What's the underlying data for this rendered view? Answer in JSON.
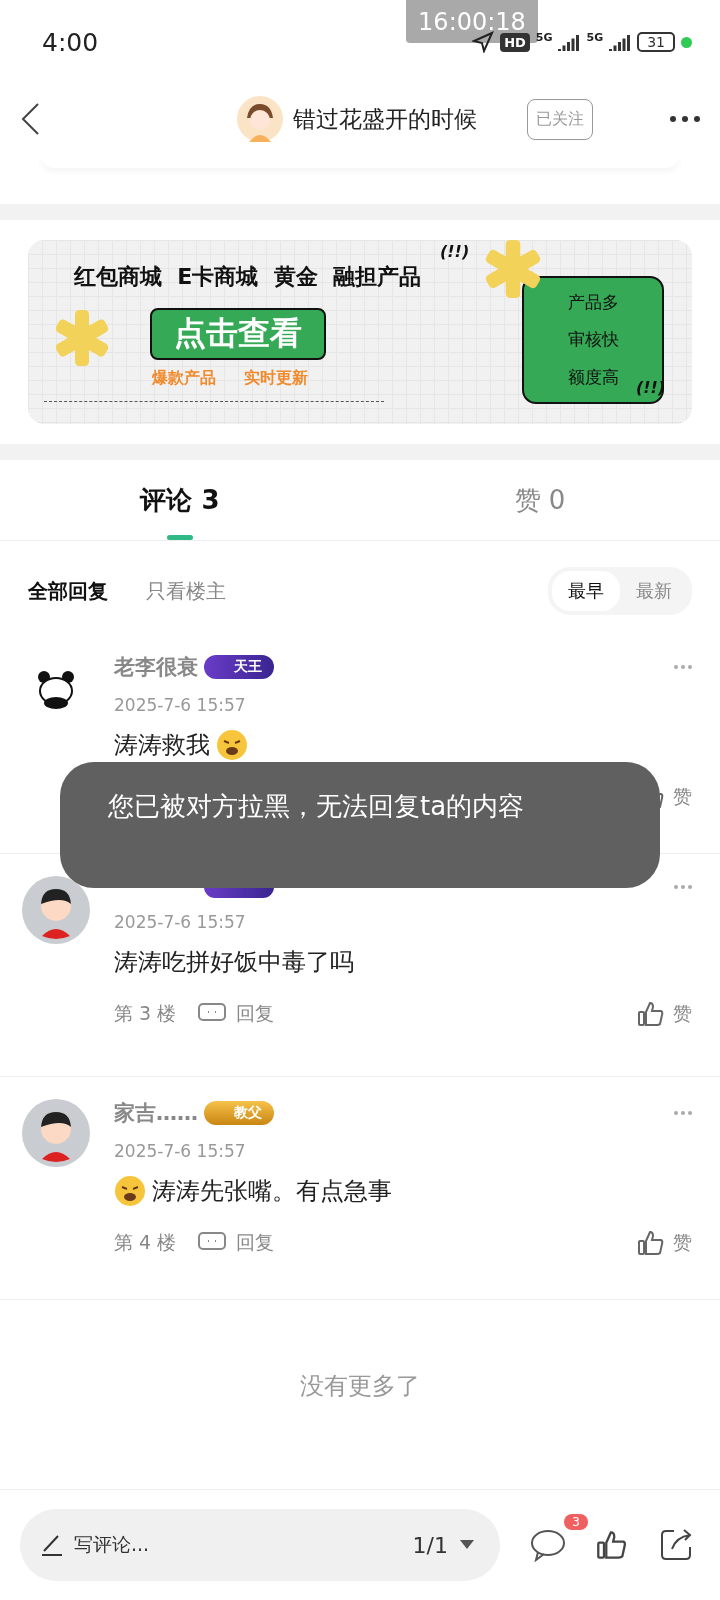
{
  "status_bar": {
    "time": "4:00",
    "recorder": "16:00:18",
    "hd": "HD",
    "networks": [
      "5G",
      "5G"
    ],
    "battery": "31"
  },
  "header": {
    "title": "错过花盛开的时候",
    "follow": "已关注"
  },
  "banner": {
    "headline": "红包商城  E卡商城  黄金  融担产品",
    "button": "点击查看",
    "tags": [
      "爆款产品",
      "实时更新"
    ],
    "features": [
      "产品多",
      "审核快",
      "额度高"
    ],
    "exclaims": [
      "(!!)",
      "(!!)"
    ]
  },
  "tabs": [
    {
      "label": "评论 3",
      "selected": true
    },
    {
      "label": "赞 0",
      "selected": false
    }
  ],
  "filters": [
    {
      "label": "全部回复",
      "selected": true
    },
    {
      "label": "只看楼主",
      "selected": false
    }
  ],
  "sort": [
    {
      "label": "最早",
      "selected": true
    },
    {
      "label": "最新",
      "selected": false
    }
  ],
  "comments": [
    {
      "name": "老李很衰",
      "avatar": {
        "kind": "panda"
      },
      "badge": {
        "kind": "tianwang",
        "text": "天王"
      },
      "time": "2025-7-6 15:57",
      "text": "涛涛救我",
      "emoji": {
        "kind": "trailing"
      },
      "like": "赞"
    },
    {
      "avatar": {
        "kind": "person"
      },
      "badge": {
        "kind": "tianwang"
      },
      "time": "2025-7-6 15:57",
      "text": "涛涛吃拼好饭中毒了吗",
      "floor": "第 3 楼",
      "reply": "回复",
      "like": "赞"
    },
    {
      "name": "家吉……",
      "avatar": {
        "kind": "person"
      },
      "badge": {
        "kind": "gold",
        "text": "教父"
      },
      "time": "2025-7-6 15:57",
      "text": "涛涛先张嘴。有点急事",
      "emoji": {
        "kind": "leading"
      },
      "floor": "第 4 楼",
      "reply": "回复",
      "like": "赞"
    }
  ],
  "end_note": "没有更多了",
  "toast": "您已被对方拉黑，无法回复ta的内容",
  "bottom_bar": {
    "placeholder": "写评论...",
    "page": "1/1",
    "comment_count": "3"
  }
}
